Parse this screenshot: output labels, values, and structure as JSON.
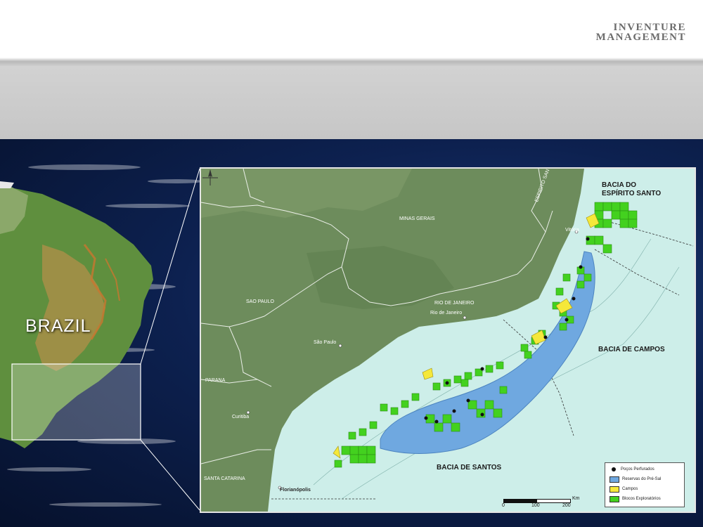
{
  "header": {
    "title": "",
    "logo_line1": "Inventure",
    "logo_line2": "Management"
  },
  "country_label": "BRAZIL",
  "map": {
    "state_labels": [
      "MINAS GERAIS",
      "ESPIRITO SANTO",
      "SAO PAULO",
      "RIO DE JANEIRO",
      "PARANA",
      "SANTA CATARINA"
    ],
    "city_labels": [
      "Vitória",
      "Rio de Janeiro",
      "São Paulo",
      "Curitiba",
      "Florianópolis"
    ],
    "basin_labels": {
      "espirito_santo": [
        "BACIA DO",
        "ESPÍRITO SANTO"
      ],
      "campos": "BACIA DE CAMPOS",
      "santos": "BACIA DE SANTOS"
    },
    "legend": [
      {
        "label": "Poços Perfurados",
        "color": "#111111",
        "kind": "dot"
      },
      {
        "label": "Reservas do Pré-Sal",
        "color": "#6fa8e0",
        "kind": "swatch"
      },
      {
        "label": "Campos",
        "color": "#f5e83a",
        "kind": "swatch"
      },
      {
        "label": "Blocos Exploratórios",
        "color": "#43d11f",
        "kind": "swatch"
      }
    ],
    "scale": {
      "unit": "Km",
      "ticks": [
        "0",
        "100",
        "200"
      ]
    },
    "colors": {
      "ocean": "#cdeee9",
      "land": "#6d8c5c",
      "presal": "#6fa8e0",
      "blocks": "#43d11f",
      "fields": "#f5e83a"
    },
    "icons": [
      "north-arrow-icon"
    ]
  }
}
